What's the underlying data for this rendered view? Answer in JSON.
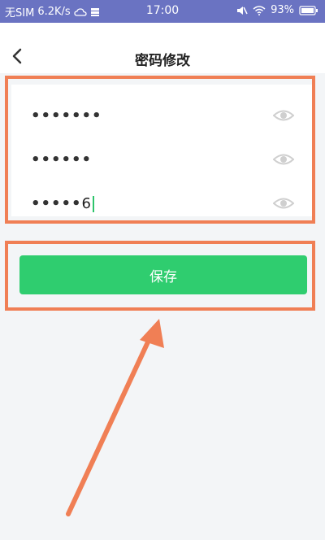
{
  "status_bar": {
    "carrier": "无SIM",
    "speed": "6.2K/s",
    "time": "17:00",
    "battery": "93%",
    "icons": [
      "weather-icon",
      "storage-icon",
      "mute-icon",
      "wifi-icon",
      "battery-icon"
    ]
  },
  "header": {
    "title": "密码修改",
    "back_icon": "chevron-left-icon"
  },
  "form": {
    "fields": [
      {
        "masked_value": "•••••••",
        "icon": "eye-icon"
      },
      {
        "masked_value": "••••••",
        "icon": "eye-icon"
      },
      {
        "masked_value": "•••••",
        "last_char": "6",
        "icon": "eye-icon"
      }
    ]
  },
  "actions": {
    "save_label": "保存"
  },
  "colors": {
    "status_bar": "#6a73c2",
    "primary_button": "#2fcd6f",
    "annotation": "#f07f55",
    "background": "#f3f5f7"
  }
}
